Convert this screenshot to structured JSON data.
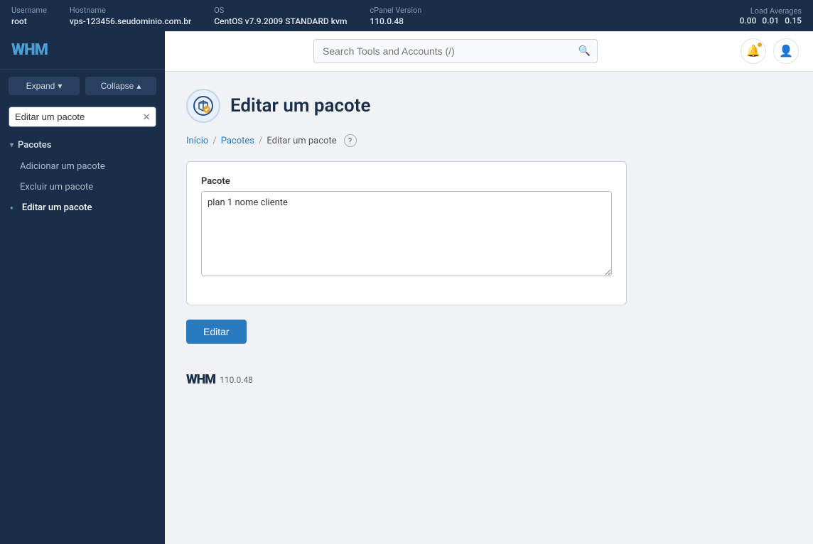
{
  "topbar": {
    "username_label": "Username",
    "username_value": "root",
    "hostname_label": "Hostname",
    "hostname_value": "vps-123456.seudominio.com.br",
    "os_label": "OS",
    "os_value": "CentOS v7.9.2009 STANDARD kvm",
    "cpanel_label": "cPanel Version",
    "cpanel_value": "110.0.48",
    "load_label": "Load Averages",
    "load_1": "0.00",
    "load_2": "0.01",
    "load_3": "0.15"
  },
  "sidebar": {
    "logo": "WHM",
    "expand_btn": "Expand",
    "collapse_btn": "Collapse",
    "search_value": "Editar um pacote",
    "search_placeholder": "Editar um pacote",
    "section_label": "Pacotes",
    "items": [
      {
        "label": "Adicionar um pacote",
        "active": false
      },
      {
        "label": "Excluir um pacote",
        "active": false
      },
      {
        "label": "Editar um pacote",
        "active": true
      }
    ]
  },
  "header": {
    "search_placeholder": "Search Tools and Accounts (/)"
  },
  "page": {
    "title": "Editar um pacote",
    "icon": "🛠",
    "breadcrumb": {
      "home": "Início",
      "section": "Pacotes",
      "current": "Editar um pacote"
    },
    "form": {
      "pacote_label": "Pacote",
      "pacote_value": "plan 1 nome cliente",
      "edit_btn": "Editar"
    }
  },
  "footer": {
    "logo": "WHM",
    "version": "110.0.48"
  }
}
